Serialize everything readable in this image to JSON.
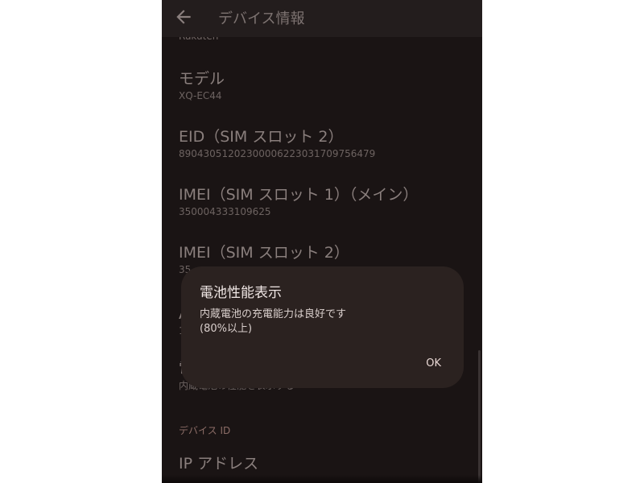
{
  "app_bar": {
    "title": "デバイス情報",
    "back_icon": "arrow-left-icon"
  },
  "partial_carrier": "Rakuten",
  "items": [
    {
      "title": "モデル",
      "value": "XQ-EC44"
    },
    {
      "title": "EID（SIM スロット 2）",
      "value": "89043051202300006223031709756479"
    },
    {
      "title": "IMEI（SIM スロット 1）（メイン）",
      "value": "350004333109625"
    },
    {
      "title": "IMEI（SIM スロット 2）",
      "value": "35"
    }
  ],
  "obscured_items": [
    {
      "title_fragment": "A",
      "value_fragment": "1"
    },
    {
      "title_fragment": "電",
      "value_fragment": "内蔵電池の性能を表示する"
    }
  ],
  "section_header": "デバイス ID",
  "ip_item_title": "IP アドレス",
  "dialog": {
    "title": "電池性能表示",
    "body_line1": "内蔵電池の充電能力は良好です",
    "body_line2": "(80%以上)",
    "ok_label": "OK"
  },
  "colors": {
    "background": "#1a1414",
    "dialog_background": "#2b2220",
    "section_header": "#8c6d67"
  }
}
